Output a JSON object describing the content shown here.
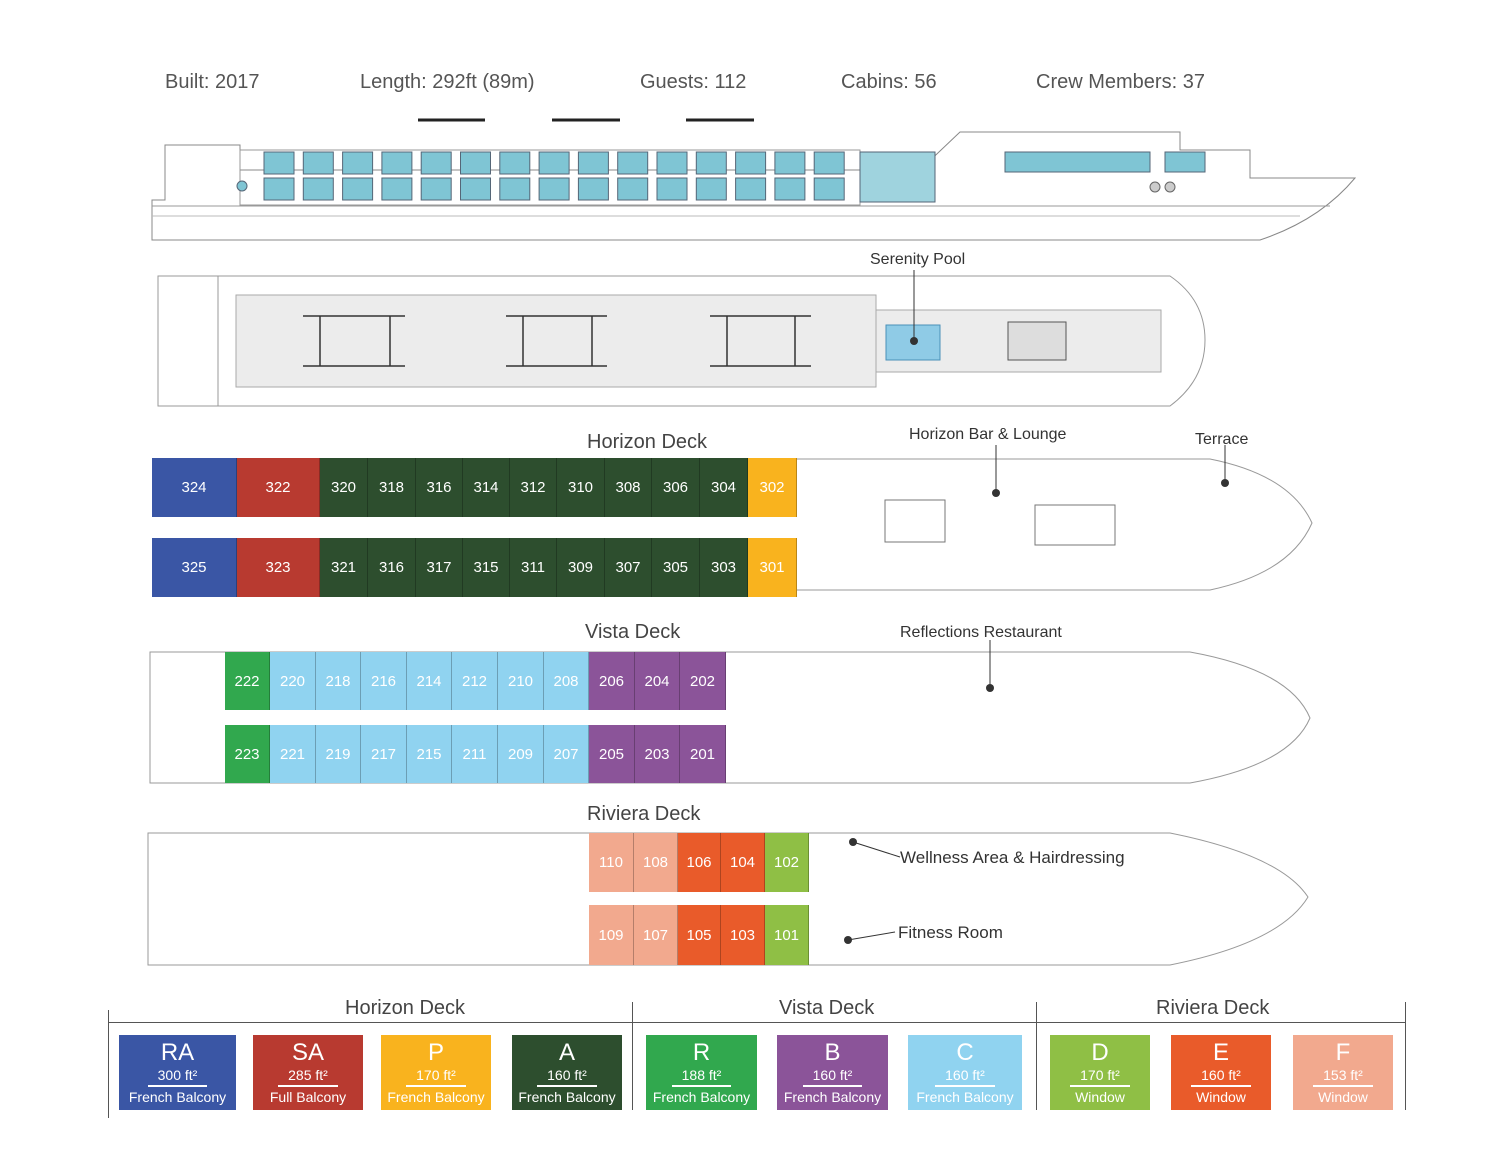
{
  "stats": {
    "built": "Built: 2017",
    "length": "Length: 292ft (89m)",
    "guests": "Guests: 112",
    "cabins": "Cabins: 56",
    "crew": "Crew Members: 37"
  },
  "colors": {
    "RA": "#3a56a5",
    "SA": "#b83a30",
    "P": "#f9b31e",
    "A": "#2d4e2e",
    "R": "#31a84e",
    "B": "#8b5499",
    "C": "#90d3f0",
    "D": "#8fbf45",
    "E": "#e95b2a",
    "F": "#f2a98e"
  },
  "sun_deck": {
    "serenity_pool": "Serenity Pool"
  },
  "horizon": {
    "title": "Horizon Deck",
    "bar": "Horizon Bar & Lounge",
    "terrace": "Terrace",
    "top": [
      [
        "324",
        "RA"
      ],
      [
        "322",
        "SA"
      ],
      [
        "320",
        "A"
      ],
      [
        "318",
        "A"
      ],
      [
        "316",
        "A"
      ],
      [
        "314",
        "A"
      ],
      [
        "312",
        "A"
      ],
      [
        "310",
        "A"
      ],
      [
        "308",
        "A"
      ],
      [
        "306",
        "A"
      ],
      [
        "304",
        "A"
      ],
      [
        "302",
        "P"
      ]
    ],
    "bottom": [
      [
        "325",
        "RA"
      ],
      [
        "323",
        "SA"
      ],
      [
        "321",
        "A"
      ],
      [
        "316",
        "A"
      ],
      [
        "317",
        "A"
      ],
      [
        "315",
        "A"
      ],
      [
        "311",
        "A"
      ],
      [
        "309",
        "A"
      ],
      [
        "307",
        "A"
      ],
      [
        "305",
        "A"
      ],
      [
        "303",
        "A"
      ],
      [
        "301",
        "P"
      ]
    ]
  },
  "vista": {
    "title": "Vista Deck",
    "restaurant": "Reflections Restaurant",
    "top": [
      [
        "222",
        "R"
      ],
      [
        "220",
        "C"
      ],
      [
        "218",
        "C"
      ],
      [
        "216",
        "C"
      ],
      [
        "214",
        "C"
      ],
      [
        "212",
        "C"
      ],
      [
        "210",
        "C"
      ],
      [
        "208",
        "C"
      ],
      [
        "206",
        "B"
      ],
      [
        "204",
        "B"
      ],
      [
        "202",
        "B"
      ]
    ],
    "bottom": [
      [
        "223",
        "R"
      ],
      [
        "221",
        "C"
      ],
      [
        "219",
        "C"
      ],
      [
        "217",
        "C"
      ],
      [
        "215",
        "C"
      ],
      [
        "211",
        "C"
      ],
      [
        "209",
        "C"
      ],
      [
        "207",
        "C"
      ],
      [
        "205",
        "B"
      ],
      [
        "203",
        "B"
      ],
      [
        "201",
        "B"
      ]
    ]
  },
  "riviera": {
    "title": "Riviera Deck",
    "wellness": "Wellness Area & Hairdressing",
    "fitness": "Fitness Room",
    "top": [
      [
        "110",
        "F"
      ],
      [
        "108",
        "F"
      ],
      [
        "106",
        "E"
      ],
      [
        "104",
        "E"
      ],
      [
        "102",
        "D"
      ]
    ],
    "bottom": [
      [
        "109",
        "F"
      ],
      [
        "107",
        "F"
      ],
      [
        "105",
        "E"
      ],
      [
        "103",
        "E"
      ],
      [
        "101",
        "D"
      ]
    ]
  },
  "legend": {
    "groups": [
      "Horizon Deck",
      "Vista Deck",
      "Riviera Deck"
    ],
    "items": [
      {
        "code": "RA",
        "size": "300 ft²",
        "type": "French Balcony"
      },
      {
        "code": "SA",
        "size": "285 ft²",
        "type": "Full Balcony"
      },
      {
        "code": "P",
        "size": "170 ft²",
        "type": "French Balcony"
      },
      {
        "code": "A",
        "size": "160 ft²",
        "type": "French Balcony"
      },
      {
        "code": "R",
        "size": "188 ft²",
        "type": "French Balcony"
      },
      {
        "code": "B",
        "size": "160 ft²",
        "type": "French Balcony"
      },
      {
        "code": "C",
        "size": "160 ft²",
        "type": "French Balcony"
      },
      {
        "code": "D",
        "size": "170 ft²",
        "type": "Window"
      },
      {
        "code": "E",
        "size": "160 ft²",
        "type": "Window"
      },
      {
        "code": "F",
        "size": "153 ft²",
        "type": "Window"
      }
    ]
  }
}
